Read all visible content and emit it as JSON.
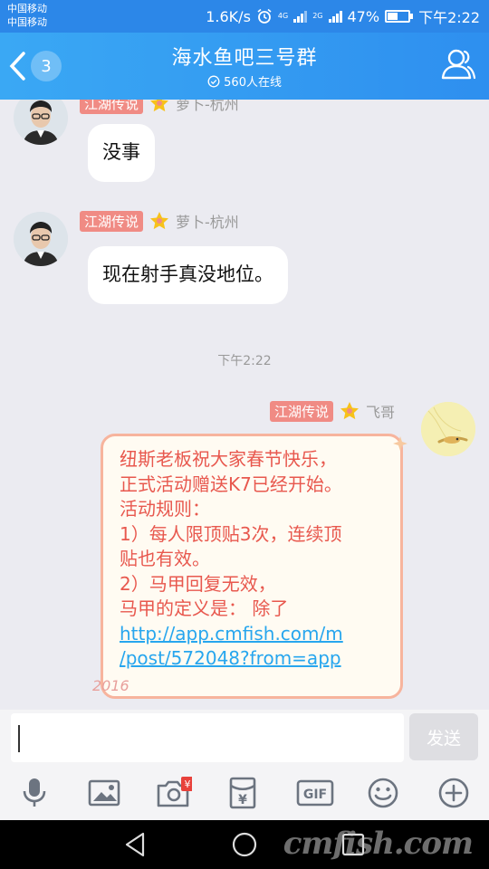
{
  "status_bar": {
    "carrier_1": "中国移动",
    "carrier_2": "中国移动",
    "speed": "1.6K/s",
    "network_1": "4G",
    "network_2": "2G",
    "battery": "47%",
    "time": "下午2:22"
  },
  "header": {
    "unread_count": "3",
    "group_name": "海水鱼吧三号群",
    "online_text": "560人在线"
  },
  "messages": [
    {
      "title_tag": "江湖传说",
      "sender": "萝卜-杭州",
      "text": "没事"
    },
    {
      "title_tag": "江湖传说",
      "sender": "萝卜-杭州",
      "text": "现在射手真没地位。"
    }
  ],
  "timestamp": "下午2:22",
  "my_message": {
    "title_tag": "江湖传说",
    "sender": "飞哥",
    "lines": [
      "纽斯老板祝大家春节快乐，",
      "正式活动赠送K7已经开始。",
      "活动规则：",
      "1）每人限顶贴3次，连续顶",
      "贴也有效。",
      "2）马甲回复无效，",
      "马甲的定义是： 除了"
    ],
    "link_line_1": "http://app.cmfish.com/m",
    "link_line_2": "/post/572048?from=app",
    "decoration": "2016"
  },
  "input": {
    "value": "",
    "send_label": "发送"
  },
  "toolbar": {
    "icons": [
      "microphone-icon",
      "image-icon",
      "camera-icon",
      "red-packet-icon",
      "gif-icon",
      "emoji-icon",
      "plus-icon"
    ],
    "gif_label": "GIF",
    "red_packet_label": "¥"
  },
  "watermark": "cmfish.com",
  "colors": {
    "header_blue": "#2e8fef",
    "title_tag": "#f08b84",
    "my_text": "#e8584e",
    "link": "#27a6ee"
  }
}
